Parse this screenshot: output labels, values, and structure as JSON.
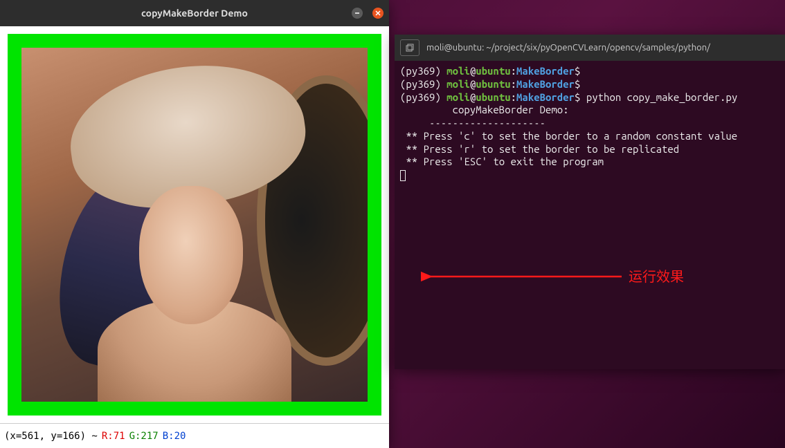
{
  "img_window": {
    "title": "copyMakeBorder Demo",
    "status": {
      "coords": "(x=561, y=166) ~",
      "r": "R:71",
      "g": "G:217",
      "b": "B:20"
    }
  },
  "terminal": {
    "title": "moli@ubuntu: ~/project/six/pyOpenCVLearn/opencv/samples/python/",
    "prompt": {
      "env": "(py369) ",
      "user": "moli",
      "at": "@",
      "host": "ubuntu",
      "colon": ":",
      "path": "MakeBorder",
      "dollar": "$"
    },
    "lines": {
      "cmd": " python copy_make_border.py",
      "blank": "",
      "out1": "         copyMakeBorder Demo: ",
      "out2": "     --------------------  ",
      "out3": " ** Press 'c' to set the border to a random constant value ",
      "out4": " ** Press 'r' to set the border to be replicated ",
      "out5": " ** Press 'ESC' to exit the program "
    }
  },
  "annotation": {
    "text": "运行效果"
  }
}
